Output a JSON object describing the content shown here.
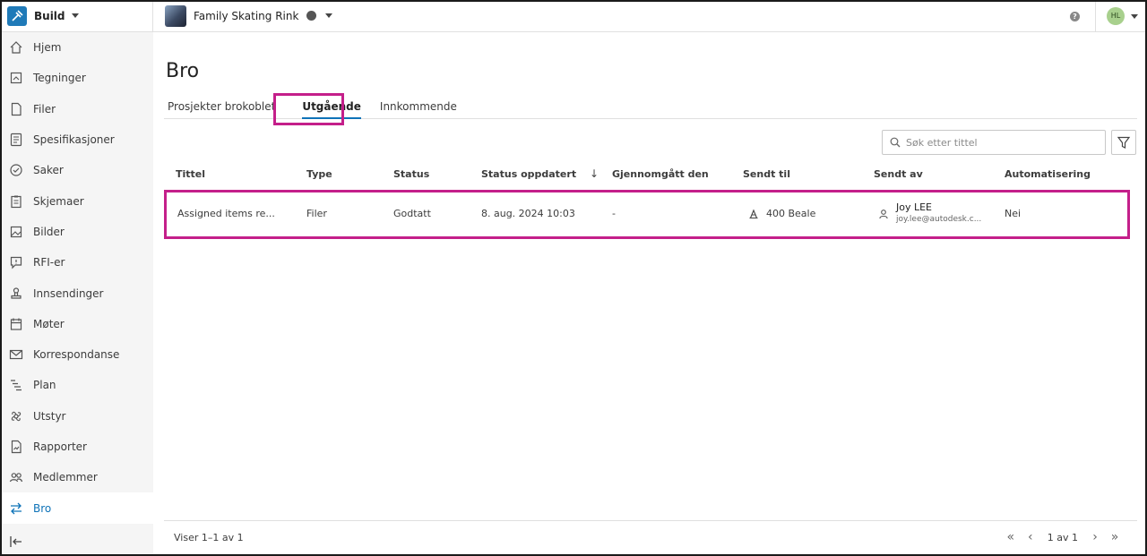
{
  "topbar": {
    "app_name": "Build",
    "project_name": "Family Skating Rink",
    "help_glyph": "?",
    "avatar_initials": "HL"
  },
  "sidebar": {
    "items": [
      {
        "label": "Hjem",
        "icon": "home-icon"
      },
      {
        "label": "Tegninger",
        "icon": "drawings-icon"
      },
      {
        "label": "Filer",
        "icon": "file-icon"
      },
      {
        "label": "Spesifikasjoner",
        "icon": "specs-icon"
      },
      {
        "label": "Saker",
        "icon": "issues-icon"
      },
      {
        "label": "Skjemaer",
        "icon": "forms-icon"
      },
      {
        "label": "Bilder",
        "icon": "photos-icon"
      },
      {
        "label": "RFI-er",
        "icon": "rfi-icon"
      },
      {
        "label": "Innsendinger",
        "icon": "submittals-icon"
      },
      {
        "label": "Møter",
        "icon": "meetings-icon"
      },
      {
        "label": "Korrespondanse",
        "icon": "mail-icon"
      },
      {
        "label": "Plan",
        "icon": "schedule-icon"
      },
      {
        "label": "Utstyr",
        "icon": "assets-icon"
      },
      {
        "label": "Rapporter",
        "icon": "reports-icon"
      },
      {
        "label": "Medlemmer",
        "icon": "members-icon"
      },
      {
        "label": "Bro",
        "icon": "bridge-icon",
        "active": true
      }
    ]
  },
  "main": {
    "title": "Bro",
    "tabs": [
      {
        "label": "Prosjekter brokoblet"
      },
      {
        "label": "Utgående",
        "active": true
      },
      {
        "label": "Innkommende"
      }
    ],
    "search_placeholder": "Søk etter tittel",
    "columns": {
      "title": "Tittel",
      "type": "Type",
      "status": "Status",
      "updated": "Status oppdatert",
      "reviewed": "Gjennomgått den",
      "sent_to": "Sendt til",
      "sent_by": "Sendt av",
      "automation": "Automatisering"
    },
    "sort_glyph": "↓",
    "rows": [
      {
        "title": "Assigned items re...",
        "type": "Filer",
        "status": "Godtatt",
        "updated": "8. aug. 2024 10:03",
        "reviewed": "-",
        "sent_to": "400 Beale",
        "sent_by_name": "Joy LEE",
        "sent_by_email": "joy.lee@autodesk.c...",
        "automation": "Nei"
      }
    ],
    "footer": {
      "info": "Viser 1–1 av 1",
      "page": "1 av 1",
      "first_glyph": "«",
      "prev_glyph": "‹",
      "next_glyph": "›",
      "last_glyph": "»"
    }
  },
  "colors": {
    "accent": "#0f73b8",
    "highlight": "#c41f8a",
    "sidebar_bg": "#f5f5f5"
  }
}
